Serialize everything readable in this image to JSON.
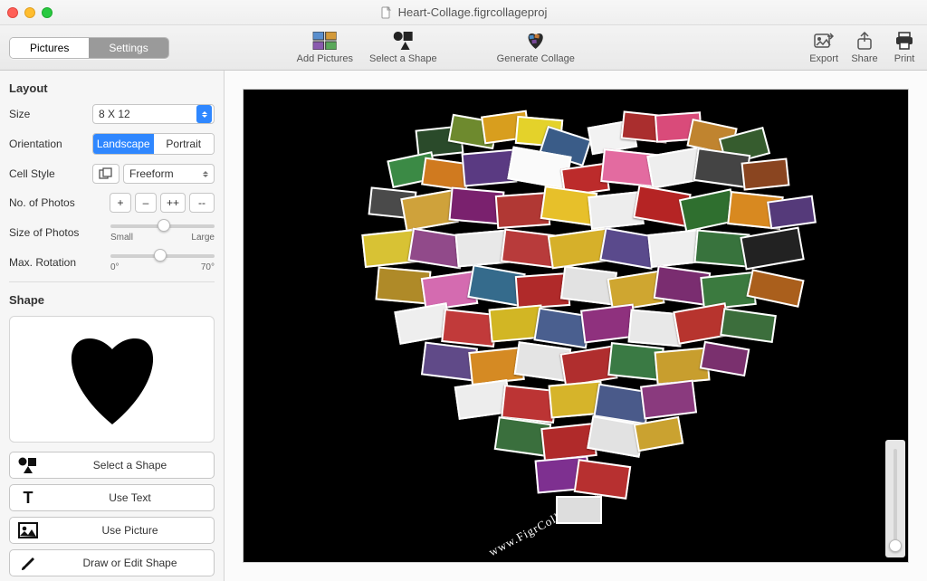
{
  "window": {
    "title": "Heart-Collage.figrcollageproj"
  },
  "tabs": {
    "pictures": "Pictures",
    "settings": "Settings",
    "active": "settings"
  },
  "toolbar": {
    "add_pictures": "Add Pictures",
    "select_shape": "Select a Shape",
    "generate": "Generate Collage",
    "export": "Export",
    "share": "Share",
    "print": "Print"
  },
  "layout": {
    "heading": "Layout",
    "size_label": "Size",
    "size_value": "8 X 12",
    "orientation_label": "Orientation",
    "landscape": "Landscape",
    "portrait": "Portrait",
    "cell_style_label": "Cell Style",
    "cell_style_value": "Freeform",
    "num_photos_label": "No. of Photos",
    "buttons": {
      "plus": "+",
      "minus": "–",
      "plus2": "++",
      "minus2": "--"
    },
    "size_photos_label": "Size of Photos",
    "size_small": "Small",
    "size_large": "Large",
    "rotation_label": "Max. Rotation",
    "rot_min": "0°",
    "rot_max": "70°"
  },
  "shape": {
    "heading": "Shape",
    "select_shape": "Select a Shape",
    "use_text": "Use Text",
    "use_picture": "Use Picture",
    "draw_edit": "Draw or Edit Shape"
  },
  "canvas": {
    "watermark": "www.FigrCollage.com"
  },
  "tiles": [
    {
      "l": 26,
      "t": 8,
      "w": 7,
      "h": 6,
      "r": -6,
      "c": "#2a4a2a"
    },
    {
      "l": 31,
      "t": 6,
      "w": 7,
      "h": 6,
      "r": 10,
      "c": "#6e8a2e"
    },
    {
      "l": 36,
      "t": 5,
      "w": 7,
      "h": 6,
      "r": -8,
      "c": "#d89e1e"
    },
    {
      "l": 41,
      "t": 6,
      "w": 7,
      "h": 6,
      "r": 5,
      "c": "#e4d22a"
    },
    {
      "l": 45,
      "t": 9,
      "w": 7,
      "h": 6,
      "r": 18,
      "c": "#3a5c88"
    },
    {
      "l": 52,
      "t": 7,
      "w": 7,
      "h": 6,
      "r": -10,
      "c": "#f2f2f2"
    },
    {
      "l": 57,
      "t": 5,
      "w": 7,
      "h": 6,
      "r": 6,
      "c": "#aa2e2e"
    },
    {
      "l": 62,
      "t": 5,
      "w": 7,
      "h": 6,
      "r": -4,
      "c": "#d94b7a"
    },
    {
      "l": 67,
      "t": 7,
      "w": 7,
      "h": 6,
      "r": 12,
      "c": "#c0842f"
    },
    {
      "l": 72,
      "t": 9,
      "w": 7,
      "h": 6,
      "r": -15,
      "c": "#365c2e"
    },
    {
      "l": 22,
      "t": 14,
      "w": 7,
      "h": 6,
      "r": -12,
      "c": "#3b8a45"
    },
    {
      "l": 27,
      "t": 15,
      "w": 7,
      "h": 6,
      "r": 8,
      "c": "#d07a1f"
    },
    {
      "l": 33,
      "t": 13,
      "w": 8,
      "h": 7,
      "r": -5,
      "c": "#5a3a82"
    },
    {
      "l": 40,
      "t": 13,
      "w": 9,
      "h": 7,
      "r": 10,
      "c": "#fafafa"
    },
    {
      "l": 48,
      "t": 16,
      "w": 7,
      "h": 6,
      "r": -8,
      "c": "#bc2b2b"
    },
    {
      "l": 54,
      "t": 13,
      "w": 8,
      "h": 7,
      "r": 6,
      "c": "#e36ba0"
    },
    {
      "l": 61,
      "t": 13,
      "w": 8,
      "h": 7,
      "r": -10,
      "c": "#eee"
    },
    {
      "l": 68,
      "t": 13,
      "w": 8,
      "h": 7,
      "r": 8,
      "c": "#444"
    },
    {
      "l": 75,
      "t": 15,
      "w": 7,
      "h": 6,
      "r": -6,
      "c": "#8a4520"
    },
    {
      "l": 19,
      "t": 21,
      "w": 7,
      "h": 6,
      "r": 6,
      "c": "#4a4a4a"
    },
    {
      "l": 24,
      "t": 22,
      "w": 8,
      "h": 7,
      "r": -10,
      "c": "#cfa23b"
    },
    {
      "l": 31,
      "t": 21,
      "w": 8,
      "h": 7,
      "r": 5,
      "c": "#7a216e"
    },
    {
      "l": 38,
      "t": 22,
      "w": 8,
      "h": 7,
      "r": -4,
      "c": "#b13834"
    },
    {
      "l": 45,
      "t": 21,
      "w": 8,
      "h": 7,
      "r": 8,
      "c": "#e7c02a"
    },
    {
      "l": 52,
      "t": 22,
      "w": 8,
      "h": 7,
      "r": -6,
      "c": "#ededed"
    },
    {
      "l": 59,
      "t": 21,
      "w": 8,
      "h": 7,
      "r": 10,
      "c": "#b52424"
    },
    {
      "l": 66,
      "t": 22,
      "w": 8,
      "h": 7,
      "r": -12,
      "c": "#2f6f2f"
    },
    {
      "l": 73,
      "t": 22,
      "w": 8,
      "h": 7,
      "r": 6,
      "c": "#d88920"
    },
    {
      "l": 79,
      "t": 23,
      "w": 7,
      "h": 6,
      "r": -8,
      "c": "#553a7a"
    },
    {
      "l": 18,
      "t": 30,
      "w": 8,
      "h": 7,
      "r": -6,
      "c": "#d8c234"
    },
    {
      "l": 25,
      "t": 30,
      "w": 8,
      "h": 7,
      "r": 9,
      "c": "#914a8a"
    },
    {
      "l": 32,
      "t": 30,
      "w": 8,
      "h": 7,
      "r": -5,
      "c": "#e8e8e8"
    },
    {
      "l": 39,
      "t": 30,
      "w": 8,
      "h": 7,
      "r": 7,
      "c": "#b83b3b"
    },
    {
      "l": 46,
      "t": 30,
      "w": 9,
      "h": 7,
      "r": -8,
      "c": "#d6b02a"
    },
    {
      "l": 54,
      "t": 30,
      "w": 8,
      "h": 7,
      "r": 10,
      "c": "#5a4a8c"
    },
    {
      "l": 61,
      "t": 30,
      "w": 8,
      "h": 7,
      "r": -6,
      "c": "#efefef"
    },
    {
      "l": 68,
      "t": 30,
      "w": 8,
      "h": 7,
      "r": 5,
      "c": "#38733d"
    },
    {
      "l": 75,
      "t": 30,
      "w": 9,
      "h": 7,
      "r": -10,
      "c": "#222"
    },
    {
      "l": 20,
      "t": 38,
      "w": 8,
      "h": 7,
      "r": 5,
      "c": "#af8a28"
    },
    {
      "l": 27,
      "t": 39,
      "w": 8,
      "h": 7,
      "r": -8,
      "c": "#d46bb0"
    },
    {
      "l": 34,
      "t": 38,
      "w": 8,
      "h": 7,
      "r": 10,
      "c": "#356b8c"
    },
    {
      "l": 41,
      "t": 39,
      "w": 8,
      "h": 7,
      "r": -4,
      "c": "#b02a2a"
    },
    {
      "l": 48,
      "t": 38,
      "w": 8,
      "h": 7,
      "r": 7,
      "c": "#e2e2e2"
    },
    {
      "l": 55,
      "t": 39,
      "w": 8,
      "h": 7,
      "r": -9,
      "c": "#cfa630"
    },
    {
      "l": 62,
      "t": 38,
      "w": 8,
      "h": 7,
      "r": 8,
      "c": "#7a2d70"
    },
    {
      "l": 69,
      "t": 39,
      "w": 8,
      "h": 7,
      "r": -6,
      "c": "#3b7a3f"
    },
    {
      "l": 76,
      "t": 39,
      "w": 8,
      "h": 6,
      "r": 12,
      "c": "#aa5f1c"
    },
    {
      "l": 23,
      "t": 46,
      "w": 8,
      "h": 7,
      "r": -10,
      "c": "#eee"
    },
    {
      "l": 30,
      "t": 47,
      "w": 8,
      "h": 7,
      "r": 6,
      "c": "#c13a3a"
    },
    {
      "l": 37,
      "t": 46,
      "w": 8,
      "h": 7,
      "r": -5,
      "c": "#d2b624"
    },
    {
      "l": 44,
      "t": 47,
      "w": 8,
      "h": 7,
      "r": 9,
      "c": "#4a5f8f"
    },
    {
      "l": 51,
      "t": 46,
      "w": 8,
      "h": 7,
      "r": -7,
      "c": "#8f317e"
    },
    {
      "l": 58,
      "t": 47,
      "w": 8,
      "h": 7,
      "r": 5,
      "c": "#e8e8e8"
    },
    {
      "l": 65,
      "t": 46,
      "w": 8,
      "h": 7,
      "r": -10,
      "c": "#b7342e"
    },
    {
      "l": 72,
      "t": 47,
      "w": 8,
      "h": 6,
      "r": 8,
      "c": "#3c6e3c"
    },
    {
      "l": 27,
      "t": 54,
      "w": 8,
      "h": 7,
      "r": 7,
      "c": "#604a88"
    },
    {
      "l": 34,
      "t": 55,
      "w": 8,
      "h": 7,
      "r": -6,
      "c": "#d58a23"
    },
    {
      "l": 41,
      "t": 54,
      "w": 8,
      "h": 7,
      "r": 8,
      "c": "#e4e4e4"
    },
    {
      "l": 48,
      "t": 55,
      "w": 8,
      "h": 7,
      "r": -9,
      "c": "#b02e2e"
    },
    {
      "l": 55,
      "t": 54,
      "w": 8,
      "h": 7,
      "r": 6,
      "c": "#3a7a44"
    },
    {
      "l": 62,
      "t": 55,
      "w": 8,
      "h": 7,
      "r": -5,
      "c": "#c89e2e"
    },
    {
      "l": 69,
      "t": 54,
      "w": 7,
      "h": 6,
      "r": 10,
      "c": "#7a306e"
    },
    {
      "l": 32,
      "t": 62,
      "w": 8,
      "h": 7,
      "r": -8,
      "c": "#ededed"
    },
    {
      "l": 39,
      "t": 63,
      "w": 8,
      "h": 7,
      "r": 6,
      "c": "#bc3434"
    },
    {
      "l": 46,
      "t": 62,
      "w": 8,
      "h": 7,
      "r": -5,
      "c": "#d6b42a"
    },
    {
      "l": 53,
      "t": 63,
      "w": 8,
      "h": 7,
      "r": 9,
      "c": "#4a5a8a"
    },
    {
      "l": 60,
      "t": 62,
      "w": 8,
      "h": 7,
      "r": -7,
      "c": "#8a3a7e"
    },
    {
      "l": 38,
      "t": 70,
      "w": 8,
      "h": 7,
      "r": 8,
      "c": "#3a6f3d"
    },
    {
      "l": 45,
      "t": 71,
      "w": 8,
      "h": 7,
      "r": -6,
      "c": "#b02a2a"
    },
    {
      "l": 52,
      "t": 70,
      "w": 8,
      "h": 7,
      "r": 10,
      "c": "#e2e2e2"
    },
    {
      "l": 59,
      "t": 70,
      "w": 7,
      "h": 6,
      "r": -10,
      "c": "#caa230"
    },
    {
      "l": 44,
      "t": 78,
      "w": 8,
      "h": 7,
      "r": -5,
      "c": "#7e3090"
    },
    {
      "l": 50,
      "t": 79,
      "w": 8,
      "h": 7,
      "r": 8,
      "c": "#b73030"
    },
    {
      "l": 47,
      "t": 86,
      "w": 7,
      "h": 6,
      "r": 0,
      "c": "#ddd"
    }
  ]
}
